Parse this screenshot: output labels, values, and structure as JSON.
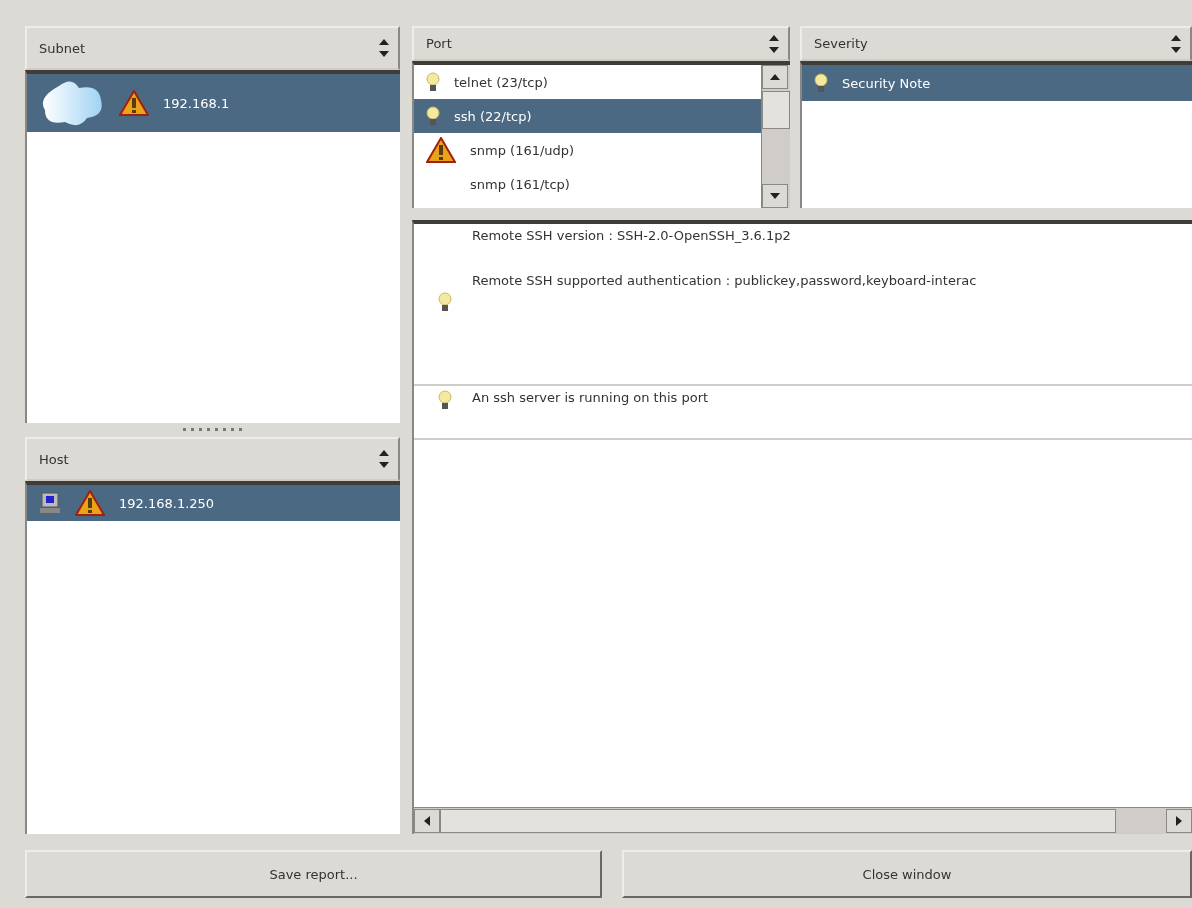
{
  "subnet": {
    "header": "Subnet",
    "rows": [
      {
        "kind": "network",
        "warning": true,
        "label": "192.168.1",
        "selected": true
      }
    ]
  },
  "host": {
    "header": "Host",
    "rows": [
      {
        "kind": "computer",
        "warning": true,
        "label": "192.168.1.250",
        "selected": true
      }
    ]
  },
  "port": {
    "header": "Port",
    "rows": [
      {
        "warning": false,
        "label": "telnet (23/tcp)",
        "selected": false
      },
      {
        "warning": false,
        "label": "ssh (22/tcp)",
        "selected": true
      },
      {
        "warning": true,
        "label": "snmp (161/udp)",
        "selected": false
      },
      {
        "label": "snmp (161/tcp)",
        "selected": false
      }
    ]
  },
  "severity": {
    "header": "Severity",
    "rows": [
      {
        "warning": false,
        "label": "Security Note",
        "selected": true
      }
    ]
  },
  "details": [
    {
      "warning": false,
      "lines": [
        "Remote SSH version : SSH-2.0-OpenSSH_3.6.1p2",
        "Remote SSH supported authentication : publickey,password,keyboard-interac"
      ]
    },
    {
      "warning": false,
      "lines": [
        "An ssh server is running on this port"
      ]
    }
  ],
  "buttons": [
    "Save report...",
    "Close window"
  ]
}
